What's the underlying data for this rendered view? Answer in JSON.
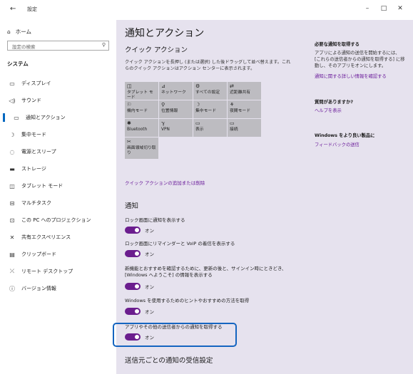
{
  "window": {
    "back": "←",
    "title": "設定",
    "minimize": "–",
    "maximize": "□",
    "close": "✕"
  },
  "sidebar": {
    "home": "ホーム",
    "search_placeholder": "設定の検索",
    "section": "システム",
    "items": [
      {
        "label": "ディスプレイ",
        "icon": "display-icon"
      },
      {
        "label": "サウンド",
        "icon": "speaker-icon"
      },
      {
        "label": "通知とアクション",
        "icon": "notification-icon"
      },
      {
        "label": "集中モード",
        "icon": "moon-icon"
      },
      {
        "label": "電源とスリープ",
        "icon": "power-icon"
      },
      {
        "label": "ストレージ",
        "icon": "storage-icon"
      },
      {
        "label": "タブレット モード",
        "icon": "tablet-icon"
      },
      {
        "label": "マルチタスク",
        "icon": "multitask-icon"
      },
      {
        "label": "この PC へのプロジェクション",
        "icon": "projection-icon"
      },
      {
        "label": "共有エクスペリエンス",
        "icon": "shared-icon"
      },
      {
        "label": "クリップボード",
        "icon": "clipboard-icon"
      },
      {
        "label": "リモート デスクトップ",
        "icon": "remote-icon"
      },
      {
        "label": "バージョン情報",
        "icon": "info-icon"
      }
    ]
  },
  "main": {
    "title": "通知とアクション",
    "quick_title": "クイック アクション",
    "quick_desc": "クイック アクションを長押し (または選択) した後ドラッグして並べ替えます。これらのクイック アクションはアクション センターに表示されます。",
    "tiles": [
      {
        "icon": "◫",
        "label": "タブレット モード"
      },
      {
        "icon": "⊿",
        "label": "ネットワーク"
      },
      {
        "icon": "⚙",
        "label": "すべての設定"
      },
      {
        "icon": "⇄",
        "label": "近距離共有"
      },
      {
        "icon": "⚐",
        "label": "機内モード"
      },
      {
        "icon": "⚲",
        "label": "位置情報"
      },
      {
        "icon": "☽",
        "label": "集中モード"
      },
      {
        "icon": "⚘",
        "label": "夜間モード"
      },
      {
        "icon": "✱",
        "label": "Bluetooth"
      },
      {
        "icon": "ℽ",
        "label": "VPN"
      },
      {
        "icon": "▭",
        "label": "表示"
      },
      {
        "icon": "▭",
        "label": "接続"
      },
      {
        "icon": "✂",
        "label": "画面領域切り取り"
      }
    ],
    "quick_link": "クイック アクションの追加または削除",
    "notif_title": "通知",
    "settings": [
      {
        "label": "ロック画面に通知を表示する",
        "state": "オン"
      },
      {
        "label": "ロック画面にリマインダーと VoIP の着信を表示する",
        "state": "オン"
      },
      {
        "label": "新機能とおすすめを確認するために、更新の後と、サインイン時にときどき、[Windows へようこそ] の情報を表示する",
        "state": "オン"
      },
      {
        "label": "Windows を使用するためのヒントやおすすめの方法を取得",
        "state": "オン"
      },
      {
        "label": "アプリやその他の送信者からの通知を取得する",
        "state": "オン"
      }
    ],
    "per_sender_title": "送信元ごとの通知の受信設定"
  },
  "right": {
    "h1": "必要な通知を取得する",
    "p1": "アプリによる通知の送信を開始するには、[これらの送信者からの通知を取得する] に移動し、そのアプリをオンにします。",
    "l1": "通知に関する詳しい情報を確認する",
    "h2": "質問がありますか?",
    "l2": "ヘルプを表示",
    "h3": "Windows をより良い製品に",
    "l3": "フィードバックの送信"
  }
}
